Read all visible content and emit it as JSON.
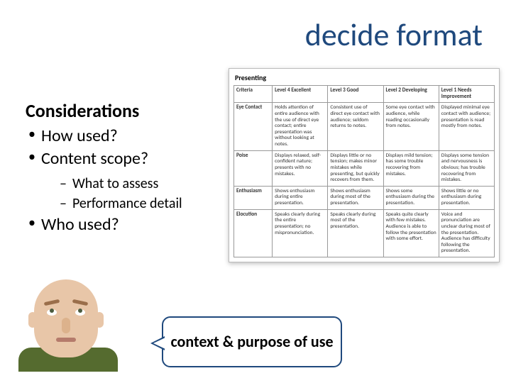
{
  "title": "decide format",
  "considerations": {
    "heading": "Considerations",
    "items": {
      "0": "How used?",
      "1": "Content scope?",
      "2": "Who used?"
    },
    "subitems": {
      "0": "What to assess",
      "1": "Performance detail"
    }
  },
  "callout": "context & purpose of use",
  "rubric": {
    "title": "Presenting",
    "headers": {
      "criteria": "Criteria",
      "l4": "Level 4 Excellent",
      "l3": "Level 3 Good",
      "l2": "Level 2 Developing",
      "l1": "Level 1 Needs Improvement"
    },
    "rows": {
      "0": {
        "label": "Eye Contact",
        "l4": "Holds attention of entire audience with the use of direct eye contact; entire presentation was without looking at notes.",
        "l3": "Consistent use of direct eye contact with audience; seldom returns to notes.",
        "l2": "Some eye contact with audience, while reading occasionally from notes.",
        "l1": "Displayed minimal eye contact with audience; presentation is read mostly from notes."
      },
      "1": {
        "label": "Poise",
        "l4": "Displays relaxed, self-confident nature; presents with no mistakes.",
        "l3": "Displays little or no tension; makes minor mistakes while presenting, but quickly recovers from them.",
        "l2": "Displays mild tension; has some trouble recovering from mistakes.",
        "l1": "Displays some tension and nervousness is obvious; has trouble recovering from mistakes."
      },
      "2": {
        "label": "Enthusiasm",
        "l4": "Shows enthusiasm during entire presentation.",
        "l3": "Shows enthusiasm during most of the presentation.",
        "l2": "Shows some enthusiasm during the presentation.",
        "l1": "Shows little or no enthusiasm during presentation."
      },
      "3": {
        "label": "Elocution",
        "l4": "Speaks clearly during the entire presentation; no mispronunciation.",
        "l3": "Speaks clearly during most of the presentation.",
        "l2": "Speaks quite clearly with few mistakes. Audience is able to follow the presentation with some effort.",
        "l1": "Voice and pronunciation are unclear during most of the presentation. Audience has difficulty following the presentation."
      }
    }
  }
}
